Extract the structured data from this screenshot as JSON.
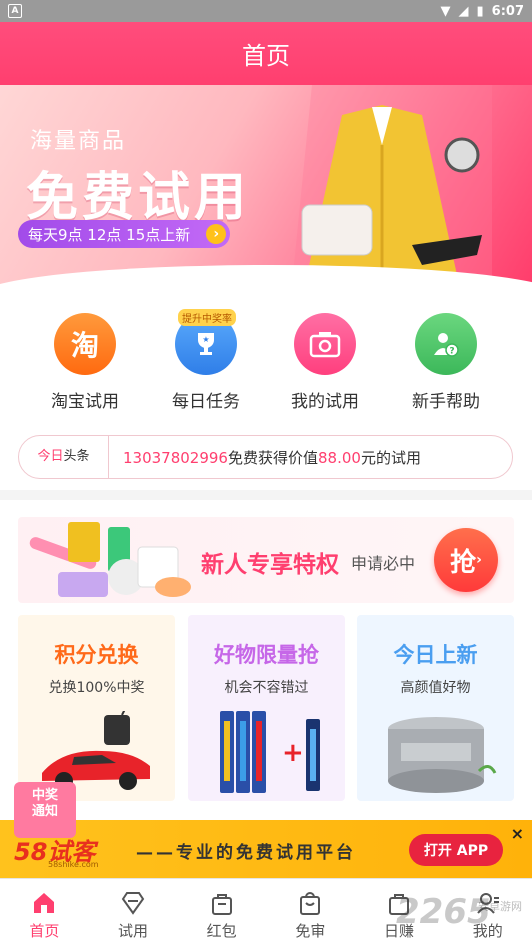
{
  "status_bar": {
    "time": "6:07"
  },
  "app_bar": {
    "title": "首页"
  },
  "banner": {
    "small_text": "海量商品",
    "big_text": "免费试用",
    "pill_text": "每天9点 12点 15点上新"
  },
  "menu": {
    "items": [
      {
        "label": "淘宝试用",
        "glyph": "淘",
        "color": "#ff7a1a"
      },
      {
        "label": "每日任务",
        "glyph": "★",
        "color": "#3d8ff5",
        "badge": "提升中奖率"
      },
      {
        "label": "我的试用",
        "glyph": "◉",
        "color": "#ff4d8a"
      },
      {
        "label": "新手帮助",
        "glyph": "?",
        "color": "#4cc86a"
      }
    ]
  },
  "news": {
    "tag_red": "今日",
    "tag_black": "头条",
    "phone": "13037802996",
    "mid": "免费获得价值",
    "amount": "88.00",
    "tail": "元的试用"
  },
  "promo": {
    "title": "新人专享特权",
    "sub": "申请必中",
    "button": "抢"
  },
  "cards": [
    {
      "title": "积分兑换",
      "sub": "兑换100%中奖",
      "color": "#ff6a1a",
      "bg": "#fff7ea"
    },
    {
      "title": "好物限量抢",
      "sub": "机会不容错过",
      "color": "#c667e8",
      "bg": "#f8f0fd"
    },
    {
      "title": "今日上新",
      "sub": "高颜值好物",
      "color": "#4a9ef0",
      "bg": "#eef6ff"
    }
  ],
  "ad": {
    "gift_line1": "中奖",
    "gift_line2": "通知",
    "logo": "58试客",
    "logo_sub": "58shike.com",
    "slogan": "——专业的免费试用平台",
    "button": "打开 APP",
    "close": "×"
  },
  "tabbar": {
    "items": [
      {
        "label": "首页",
        "active": true
      },
      {
        "label": "试用",
        "active": false
      },
      {
        "label": "红包",
        "active": false
      },
      {
        "label": "免审",
        "active": false
      },
      {
        "label": "日赚",
        "active": false
      },
      {
        "label": "我的",
        "active": false
      }
    ]
  },
  "watermark": {
    "text": "2265",
    "sub": "安卓游网"
  }
}
